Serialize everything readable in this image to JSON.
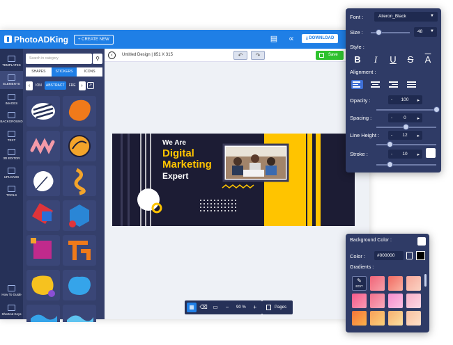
{
  "app": {
    "logo": "PhotoADKing",
    "create_new": "+ CREATE NEW",
    "download": "DOWNLOAD"
  },
  "leftnav": [
    {
      "label": "TEMPLATES"
    },
    {
      "label": "ELEMENTS"
    },
    {
      "label": "IMAGES"
    },
    {
      "label": "BACKGROUND"
    },
    {
      "label": "TEXT"
    },
    {
      "label": "3D EDITOR"
    },
    {
      "label": "UPLOADS"
    },
    {
      "label": "TOOLS"
    },
    {
      "label": "How To Guide"
    },
    {
      "label": "Shortcut Keys"
    }
  ],
  "panel": {
    "search_placeholder": "Search in category",
    "tabs": [
      "SHAPES",
      "STICKERS",
      "ICONS"
    ],
    "categories": [
      "ION",
      "ABSTRACT",
      "FRE"
    ]
  },
  "canvas": {
    "design_name": "Untitled Design | 851 X 315",
    "save": "Save",
    "zoom": "90 %",
    "pages": "Pages"
  },
  "banner": {
    "line1": "We Are",
    "line2": "Digital",
    "line3": "Marketing",
    "line4": "Expert"
  },
  "text_panel": {
    "font_label": "Font :",
    "font_value": "Aileron_Black",
    "size_label": "Size :",
    "size_value": "48",
    "style_label": "Style :",
    "alignment_label": "Alignment :",
    "opacity_label": "Opacity :",
    "opacity_value": "100",
    "spacing_label": "Spacing :",
    "spacing_value": "0",
    "lineheight_label": "Line Height :",
    "lineheight_value": "12",
    "stroke_label": "Stroke :",
    "stroke_value": "10"
  },
  "bg_panel": {
    "title": "Background Color :",
    "color_label": "Color :",
    "color_value": "#000000",
    "gradients_label": "Gradients :",
    "edit_label": "EDIT"
  },
  "colors": {
    "primary": "#1f7fe6",
    "dark": "#263158",
    "accent": "#ffc400",
    "save": "#2ec22e"
  }
}
